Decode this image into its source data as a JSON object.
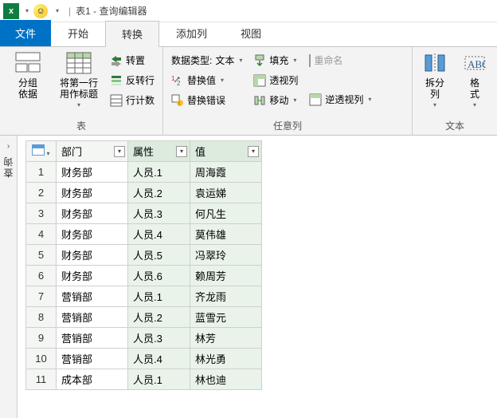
{
  "titlebar": {
    "title": "表1 - 查询编辑器",
    "sep": "|"
  },
  "tabs": {
    "file": "文件",
    "items": [
      {
        "label": "开始"
      },
      {
        "label": "转换",
        "active": true
      },
      {
        "label": "添加列"
      },
      {
        "label": "视图"
      }
    ]
  },
  "ribbon": {
    "group_table": {
      "label": "表",
      "group_by": "分组\n依据",
      "first_row": "将第一行\n用作标题",
      "transpose": "转置",
      "reverse_rows": "反转行",
      "row_count": "行计数"
    },
    "group_anycol": {
      "label": "任意列",
      "data_type_prefix": "数据类型: ",
      "data_type_value": "文本",
      "replace_values": "替换值",
      "replace_errors": "替换错误",
      "fill": "填充",
      "pivot": "透视列",
      "move": "移动",
      "unpivot": "逆透视列",
      "rename": "重命名"
    },
    "group_text": {
      "label": "文本",
      "split": "拆分\n列",
      "format": "格\n式"
    }
  },
  "sidebar": {
    "label": "查询"
  },
  "grid": {
    "headers": {
      "dept": "部门",
      "attr": "属性",
      "val": "值"
    },
    "rows": [
      {
        "n": "1",
        "dept": "财务部",
        "attr": "人员.1",
        "val": "周海霞"
      },
      {
        "n": "2",
        "dept": "财务部",
        "attr": "人员.2",
        "val": "袁运娣"
      },
      {
        "n": "3",
        "dept": "财务部",
        "attr": "人员.3",
        "val": "何凡生"
      },
      {
        "n": "4",
        "dept": "财务部",
        "attr": "人员.4",
        "val": "莫伟雄"
      },
      {
        "n": "5",
        "dept": "财务部",
        "attr": "人员.5",
        "val": "冯翠玲"
      },
      {
        "n": "6",
        "dept": "财务部",
        "attr": "人员.6",
        "val": "赖周芳"
      },
      {
        "n": "7",
        "dept": "营销部",
        "attr": "人员.1",
        "val": "齐龙雨"
      },
      {
        "n": "8",
        "dept": "营销部",
        "attr": "人员.2",
        "val": "蓝雪元"
      },
      {
        "n": "9",
        "dept": "营销部",
        "attr": "人员.3",
        "val": "林芳"
      },
      {
        "n": "10",
        "dept": "营销部",
        "attr": "人员.4",
        "val": "林光勇"
      },
      {
        "n": "11",
        "dept": "成本部",
        "attr": "人员.1",
        "val": "林也迪"
      }
    ]
  }
}
